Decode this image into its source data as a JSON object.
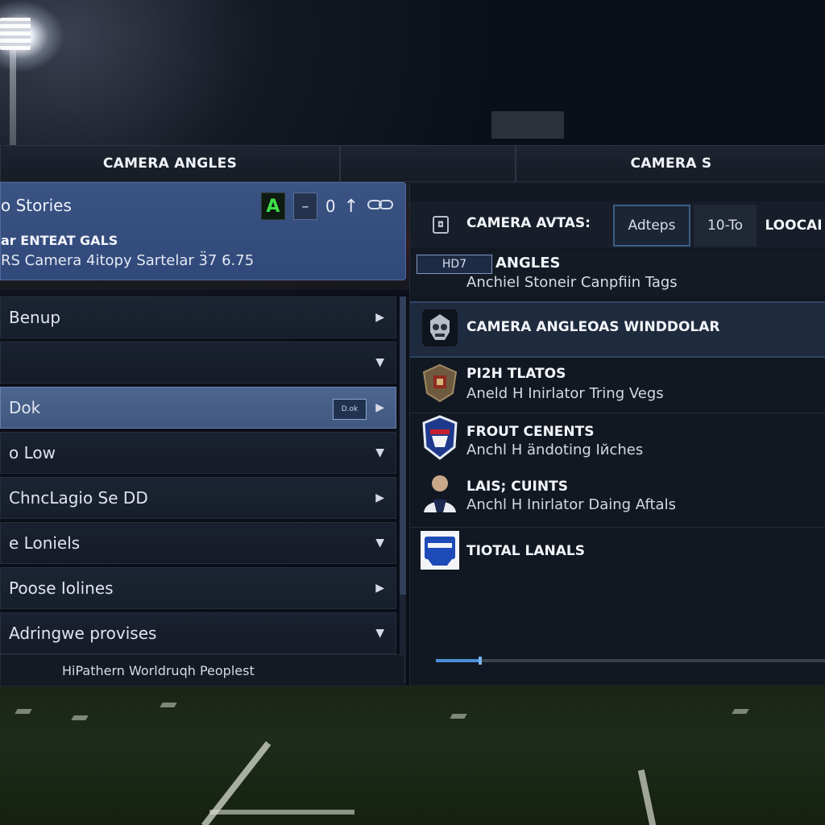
{
  "header": {
    "tab_left": "CAMERA ANGLES",
    "tab_mid": "",
    "tab_right": "CAMERA S"
  },
  "story": {
    "title": "o Stories",
    "toolbar": {
      "a_label": "A",
      "minus_label": "–",
      "count": "0",
      "up_arrow": "↑",
      "link_icon": "link-icon"
    },
    "subtitle": "ar ENTEAT GALS",
    "line": "RS Camera 4itopy Sartelar 3̈7 6.75"
  },
  "menu": {
    "items": [
      {
        "label": "Benup",
        "arrow": "▶"
      },
      {
        "label": "",
        "arrow": "▼"
      },
      {
        "label": "Dok",
        "arrow": "▶",
        "badge": "D.ok"
      },
      {
        "label": "o Low",
        "arrow": "▼"
      },
      {
        "label": "ChncLagio Se DD",
        "arrow": "▶"
      },
      {
        "label": "e Loniels",
        "arrow": "▼"
      },
      {
        "label": "Poose Iolines",
        "arrow": "▶"
      },
      {
        "label": "Adringwe provises",
        "arrow": "▼"
      }
    ],
    "footer": "HiPathern Worldruqh Peoplest"
  },
  "right_panel": {
    "camera_label": "CAMERA AVTAS:",
    "tabs": [
      "Adteps",
      "10-To",
      "LOOCAI"
    ],
    "angles_box": "HD7",
    "angles_title": "ANGLES",
    "angles_sub": "Anchiel Stoneir Canpfiin Tags",
    "entries": [
      {
        "title": "CAMERA ANGLEOAS WINDDOLAR",
        "subtitle": "",
        "icon": "skull-crest-icon"
      },
      {
        "title": "PI2H TLATOS",
        "subtitle": "Aneld H Inirlator Tring Vegs",
        "icon": "shield-crest-icon"
      },
      {
        "title": "FROUT CENENTS",
        "subtitle": "Anchl H ändoting Iйches",
        "icon": "team-badge-icon"
      },
      {
        "title": "LAIS; CUINTS",
        "subtitle": "Anchl H Inirlator Daing Aftals",
        "icon": "player-portrait-icon"
      },
      {
        "title": "TIOTAL LANALS",
        "subtitle": "",
        "icon": "blue-logo-icon"
      }
    ],
    "progress": 0.11
  },
  "colors": {
    "accent": "#3a5383",
    "highlight": "#4d6690",
    "progress": "#4a8fd8",
    "a_button": "#3ee04a"
  }
}
